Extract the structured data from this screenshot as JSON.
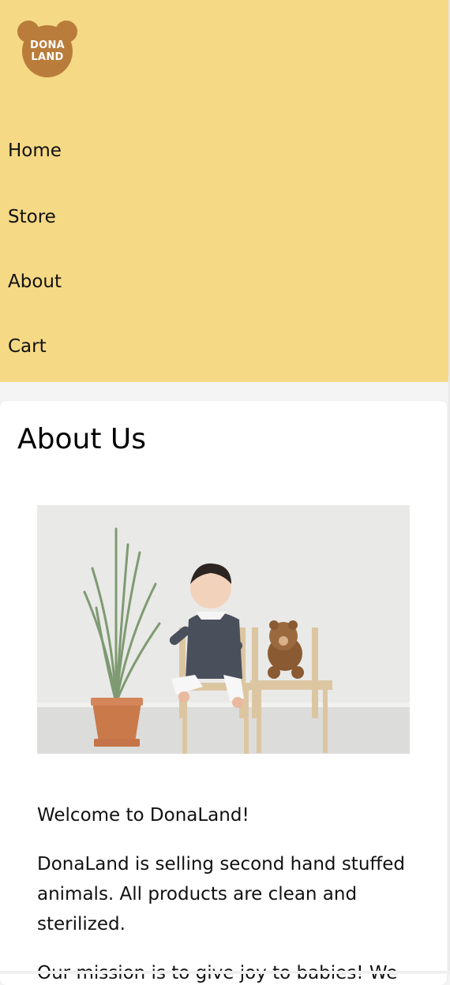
{
  "logo": {
    "line1": "DONA",
    "line2": "LAND"
  },
  "nav": {
    "items": [
      {
        "label": "Home"
      },
      {
        "label": "Store"
      },
      {
        "label": "About"
      },
      {
        "label": "Cart"
      }
    ]
  },
  "colors": {
    "header_bg": "#f5d985",
    "logo_brown": "#b97c3a",
    "page_bg": "#f4f4f4",
    "card_bg": "#ffffff"
  },
  "about": {
    "title": "About Us",
    "welcome": "Welcome to DonaLand!",
    "paragraph1": "DonaLand is selling second hand stuffed animals. All products are clean and sterilized.",
    "paragraph2": "Our mission is to give joy to babies! We"
  }
}
